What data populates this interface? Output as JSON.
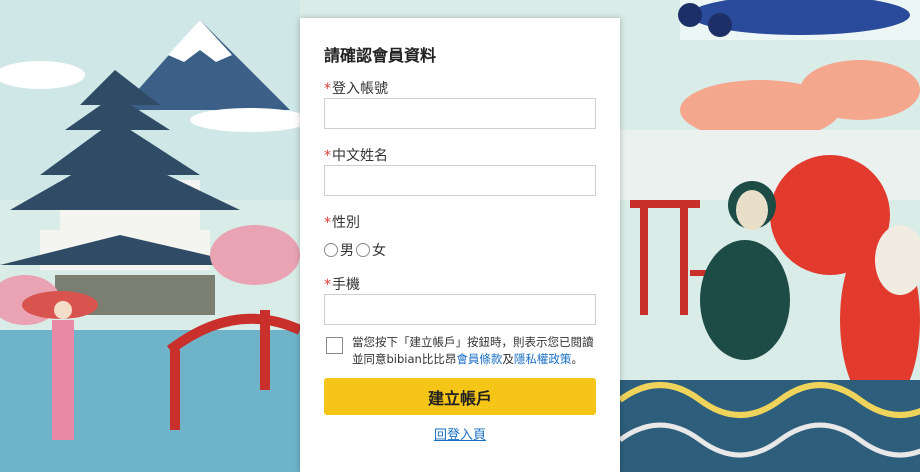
{
  "form": {
    "title": "請確認會員資料",
    "required_mark": "*",
    "account_label": "登入帳號",
    "name_label": "中文姓名",
    "gender_label": "性別",
    "gender_male": "男",
    "gender_female": "女",
    "phone_label": "手機",
    "agree_text_1": "當您按下「建立帳戶」按鈕時，則表示您已閱讀並同意bibian比比昂",
    "terms_link": "會員條款",
    "agree_and": "及",
    "privacy_link": "隱私權政策",
    "agree_end": "。",
    "submit_label": "建立帳戶",
    "back_label": "回登入頁"
  },
  "colors": {
    "accent": "#f5c518",
    "required": "#e03a3a",
    "link": "#1a6fc4"
  }
}
